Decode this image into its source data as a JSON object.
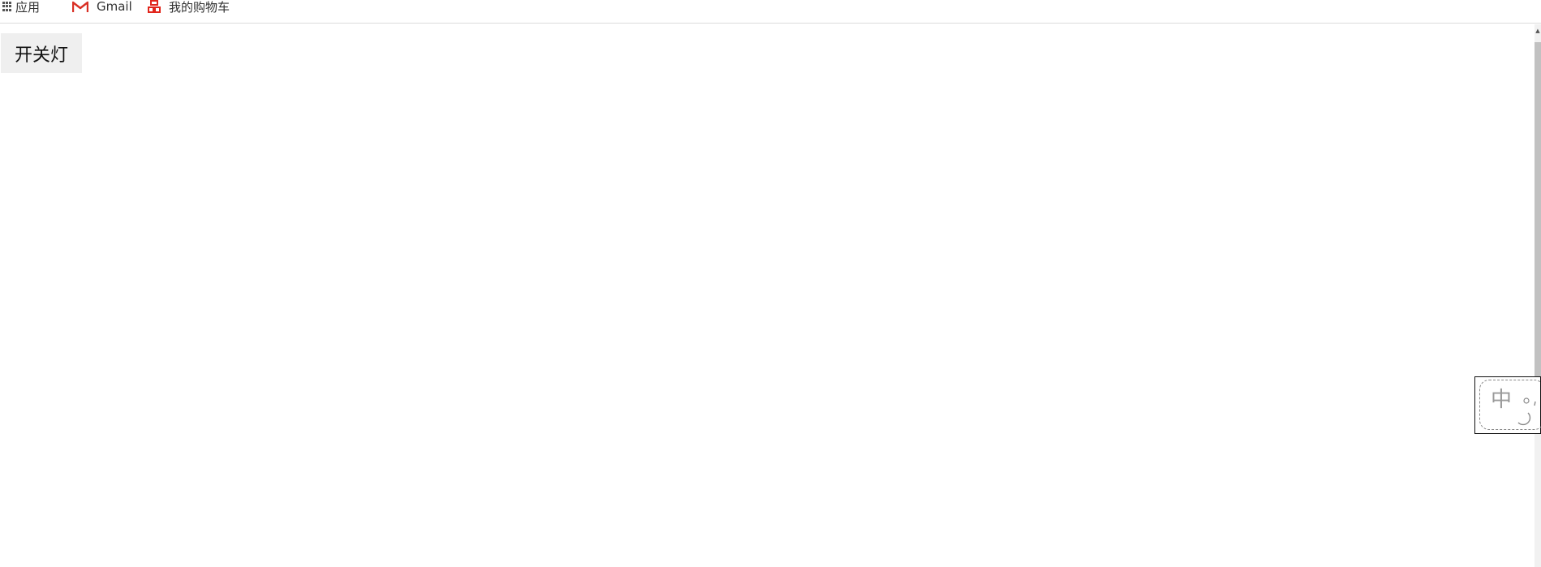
{
  "bookmarks": {
    "apps_label": "应用",
    "gmail_label": "Gmail",
    "cart_label": "我的购物车"
  },
  "page": {
    "toggle_button_label": "开关灯"
  },
  "ime": {
    "mode_char": "中",
    "punct_mode": "°,"
  },
  "colors": {
    "gmail_red": "#d93025",
    "cart_red": "#e1251b",
    "button_bg": "#efefef"
  }
}
